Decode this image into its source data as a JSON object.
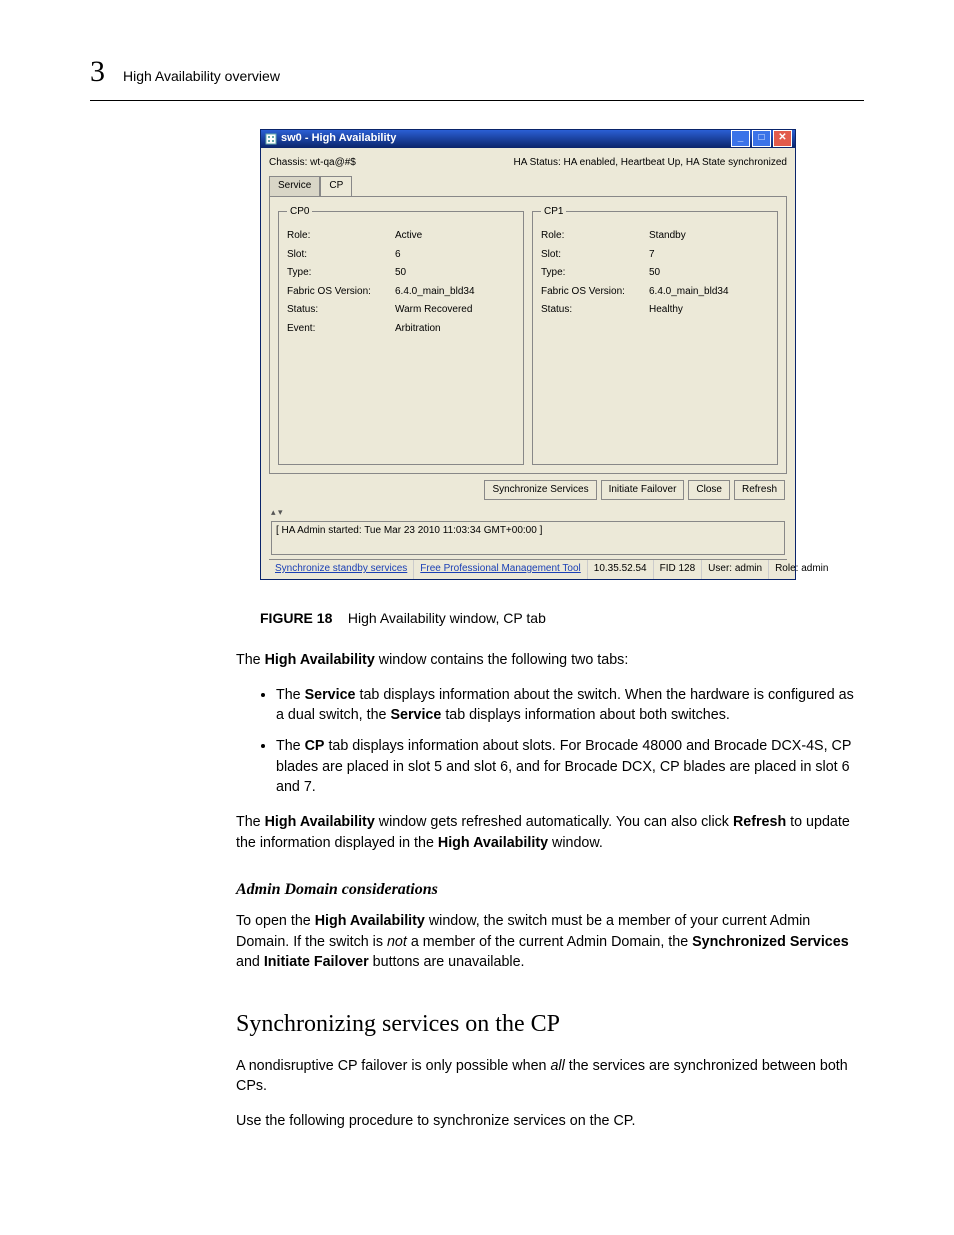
{
  "header": {
    "chapter_number": "3",
    "section_title": "High Availability overview"
  },
  "window": {
    "title": "sw0 - High Availability",
    "chassis_label": "Chassis:",
    "chassis_value": "wt-qa@#$",
    "hastatus_label": "HA Status:",
    "hastatus_value": "HA enabled, Heartbeat Up, HA State synchronized",
    "tabs": {
      "service": "Service",
      "cp": "CP"
    },
    "cp0": {
      "legend": "CP0",
      "role_l": "Role:",
      "role_v": "Active",
      "slot_l": "Slot:",
      "slot_v": "6",
      "type_l": "Type:",
      "type_v": "50",
      "fos_l": "Fabric OS Version:",
      "fos_v": "6.4.0_main_bld34",
      "status_l": "Status:",
      "status_v": "Warm Recovered",
      "event_l": "Event:",
      "event_v": "Arbitration"
    },
    "cp1": {
      "legend": "CP1",
      "role_l": "Role:",
      "role_v": "Standby",
      "slot_l": "Slot:",
      "slot_v": "7",
      "type_l": "Type:",
      "type_v": "50",
      "fos_l": "Fabric OS Version:",
      "fos_v": "6.4.0_main_bld34",
      "status_l": "Status:",
      "status_v": "Healthy"
    },
    "buttons": {
      "sync": "Synchronize Services",
      "failover": "Initiate Failover",
      "close": "Close",
      "refresh": "Refresh"
    },
    "log_line": "[ HA Admin started: Tue Mar 23 2010 11:03:34 GMT+00:00 ]",
    "statusbar": {
      "sync_link": "Synchronize standby services",
      "tool_link": "Free Professional Management Tool",
      "ip": "10.35.52.54",
      "fid": "FID 128",
      "user": "User: admin",
      "role": "Role: admin"
    }
  },
  "caption": {
    "label": "FIGURE 18",
    "text": "High Availability window, CP tab"
  },
  "para1": {
    "pre": "The ",
    "b1": "High Availability",
    "post": " window contains the following two tabs:"
  },
  "bullet1": {
    "pre": "The ",
    "b1": "Service",
    "mid": " tab displays information about the switch. When the hardware is configured as a dual switch, the ",
    "b2": "Service",
    "post": " tab displays information about both switches."
  },
  "bullet2": {
    "pre": "The ",
    "b1": "CP",
    "post": " tab displays information about slots. For Brocade 48000 and Brocade DCX-4S, CP blades are placed in slot 5 and slot 6, and for Brocade DCX, CP blades are placed in slot 6 and 7."
  },
  "para2": {
    "pre": "The ",
    "b1": "High Availability",
    "mid": " window gets refreshed automatically. You can also click ",
    "b2": "Refresh",
    "mid2": " to update the information displayed in the ",
    "b3": "High Availability",
    "post": " window."
  },
  "subhead": "Admin Domain considerations",
  "para3": {
    "pre": "To open the ",
    "b1": "High Availability",
    "mid": " window, the switch must be a member of your current Admin Domain. If the switch is ",
    "i1": "not",
    "mid2": " a member of the current Admin Domain, the ",
    "b2": "Synchronized Services",
    "mid3": " and ",
    "b3": "Initiate Failover",
    "post": " buttons are unavailable."
  },
  "h2": "Synchronizing services on the CP",
  "para4": {
    "pre": "A nondisruptive CP failover is only possible when ",
    "i1": "all",
    "post": " the services are synchronized between both CPs."
  },
  "para5": "Use the following procedure to synchronize services on the CP."
}
